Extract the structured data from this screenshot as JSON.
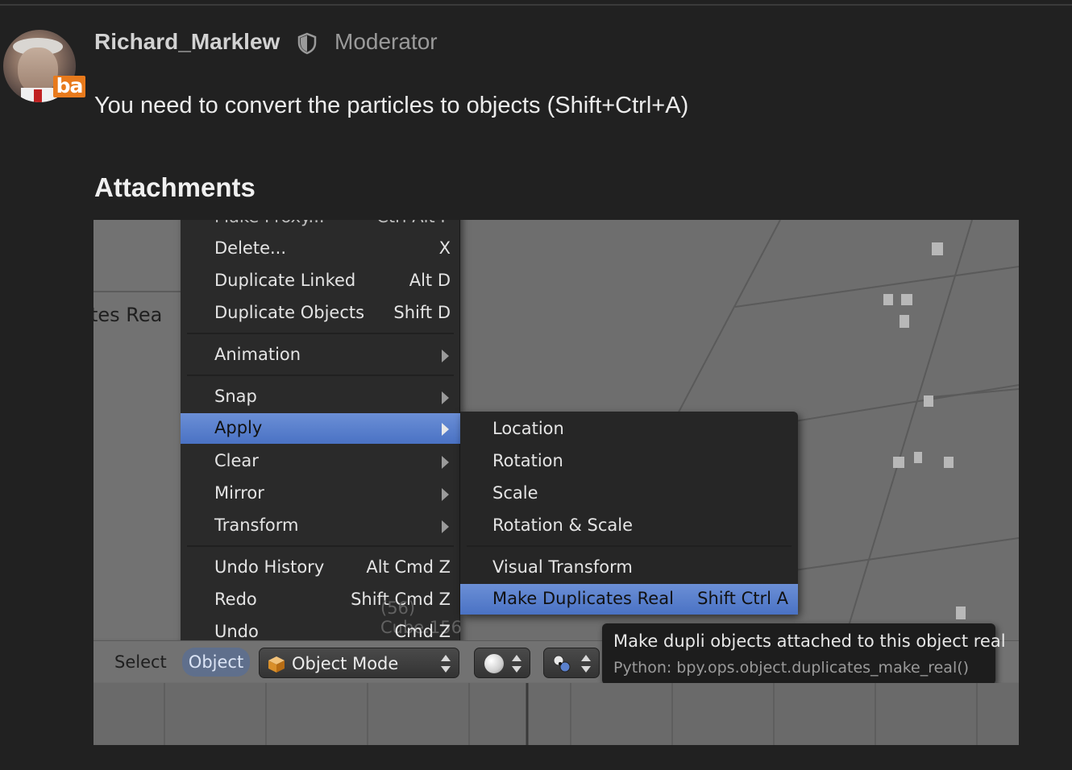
{
  "post": {
    "username": "Richard_Marklew",
    "role": "Moderator",
    "avatar_badge": "ba",
    "message": "You need to convert the particles to objects (Shift+Ctrl+A)",
    "attachments_heading": "Attachments"
  },
  "screenshot": {
    "left_panel_text": "tes Rea",
    "ghost_text": "(56) Cube.156",
    "menu": {
      "cut_item": {
        "label": "Make Proxy...",
        "shortcut": "Ctrl Alt P"
      },
      "items": [
        {
          "label": "Delete...",
          "shortcut": "X"
        },
        {
          "label": "Duplicate Linked",
          "shortcut": "Alt D"
        },
        {
          "label": "Duplicate Objects",
          "shortcut": "Shift D"
        },
        {
          "label": "Animation",
          "submenu": true
        },
        {
          "label": "Snap",
          "submenu": true
        },
        {
          "label": "Apply",
          "submenu": true,
          "highlighted": true
        },
        {
          "label": "Clear",
          "submenu": true
        },
        {
          "label": "Mirror",
          "submenu": true
        },
        {
          "label": "Transform",
          "submenu": true
        },
        {
          "label": "Undo History",
          "shortcut": "Alt Cmd Z"
        },
        {
          "label": "Redo",
          "shortcut": "Shift Cmd Z"
        },
        {
          "label": "Undo",
          "shortcut": "Cmd Z"
        }
      ]
    },
    "submenu": {
      "items": [
        {
          "label": "Location"
        },
        {
          "label": "Rotation"
        },
        {
          "label": "Scale"
        },
        {
          "label": "Rotation & Scale"
        },
        {
          "label": "Visual Transform"
        },
        {
          "label": "Make Duplicates Real",
          "shortcut": "Shift Ctrl A",
          "highlighted": true
        }
      ]
    },
    "tooltip": {
      "description": "Make dupli objects attached to this object real",
      "python": "Python: bpy.ops.object.duplicates_make_real()"
    },
    "header": {
      "select_label": "Select",
      "object_label": "Object",
      "mode_label": "Object Mode"
    },
    "colors": {
      "highlight": "#5a80cc",
      "badge": "#e87a1c"
    }
  }
}
